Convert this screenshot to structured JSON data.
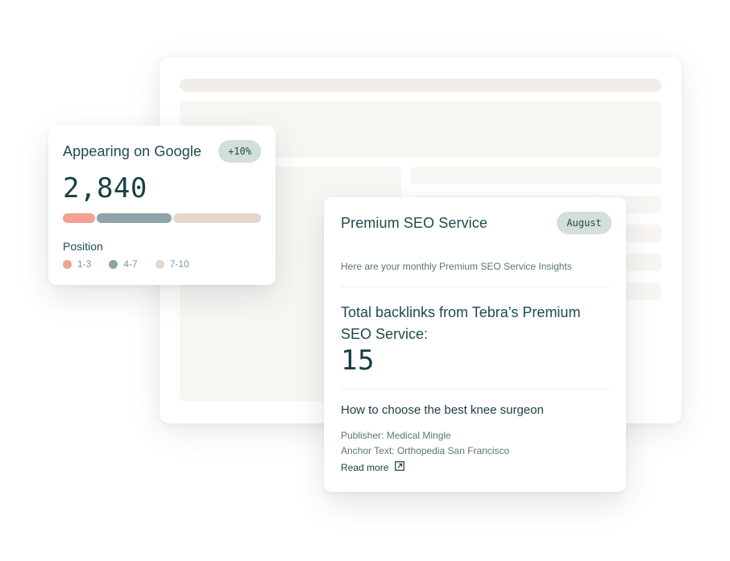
{
  "google_card": {
    "title": "Appearing on Google",
    "change_badge": "+10%",
    "count": "2,840",
    "position_label": "Position",
    "legend": [
      {
        "label": "1-3",
        "color": "#f4a092"
      },
      {
        "label": "4-7",
        "color": "#8ea4a8"
      },
      {
        "label": "7-10",
        "color": "#e4d7cd"
      }
    ]
  },
  "seo_card": {
    "title": "Premium SEO Service",
    "month_badge": "August",
    "subtitle": "Here are your monthly Premium SEO Service Insights",
    "backlinks_label": "Total backlinks from Tebra’s Premium SEO Service:",
    "backlinks_count": "15",
    "article_title": "How to choose the best knee surgeon",
    "publisher": "Publisher: Medical Mingle",
    "anchor_text": "Anchor Text: Orthopedia San Francisco",
    "read_more": "Read more"
  },
  "icons": {
    "read_more_icon": "external-link-icon"
  }
}
